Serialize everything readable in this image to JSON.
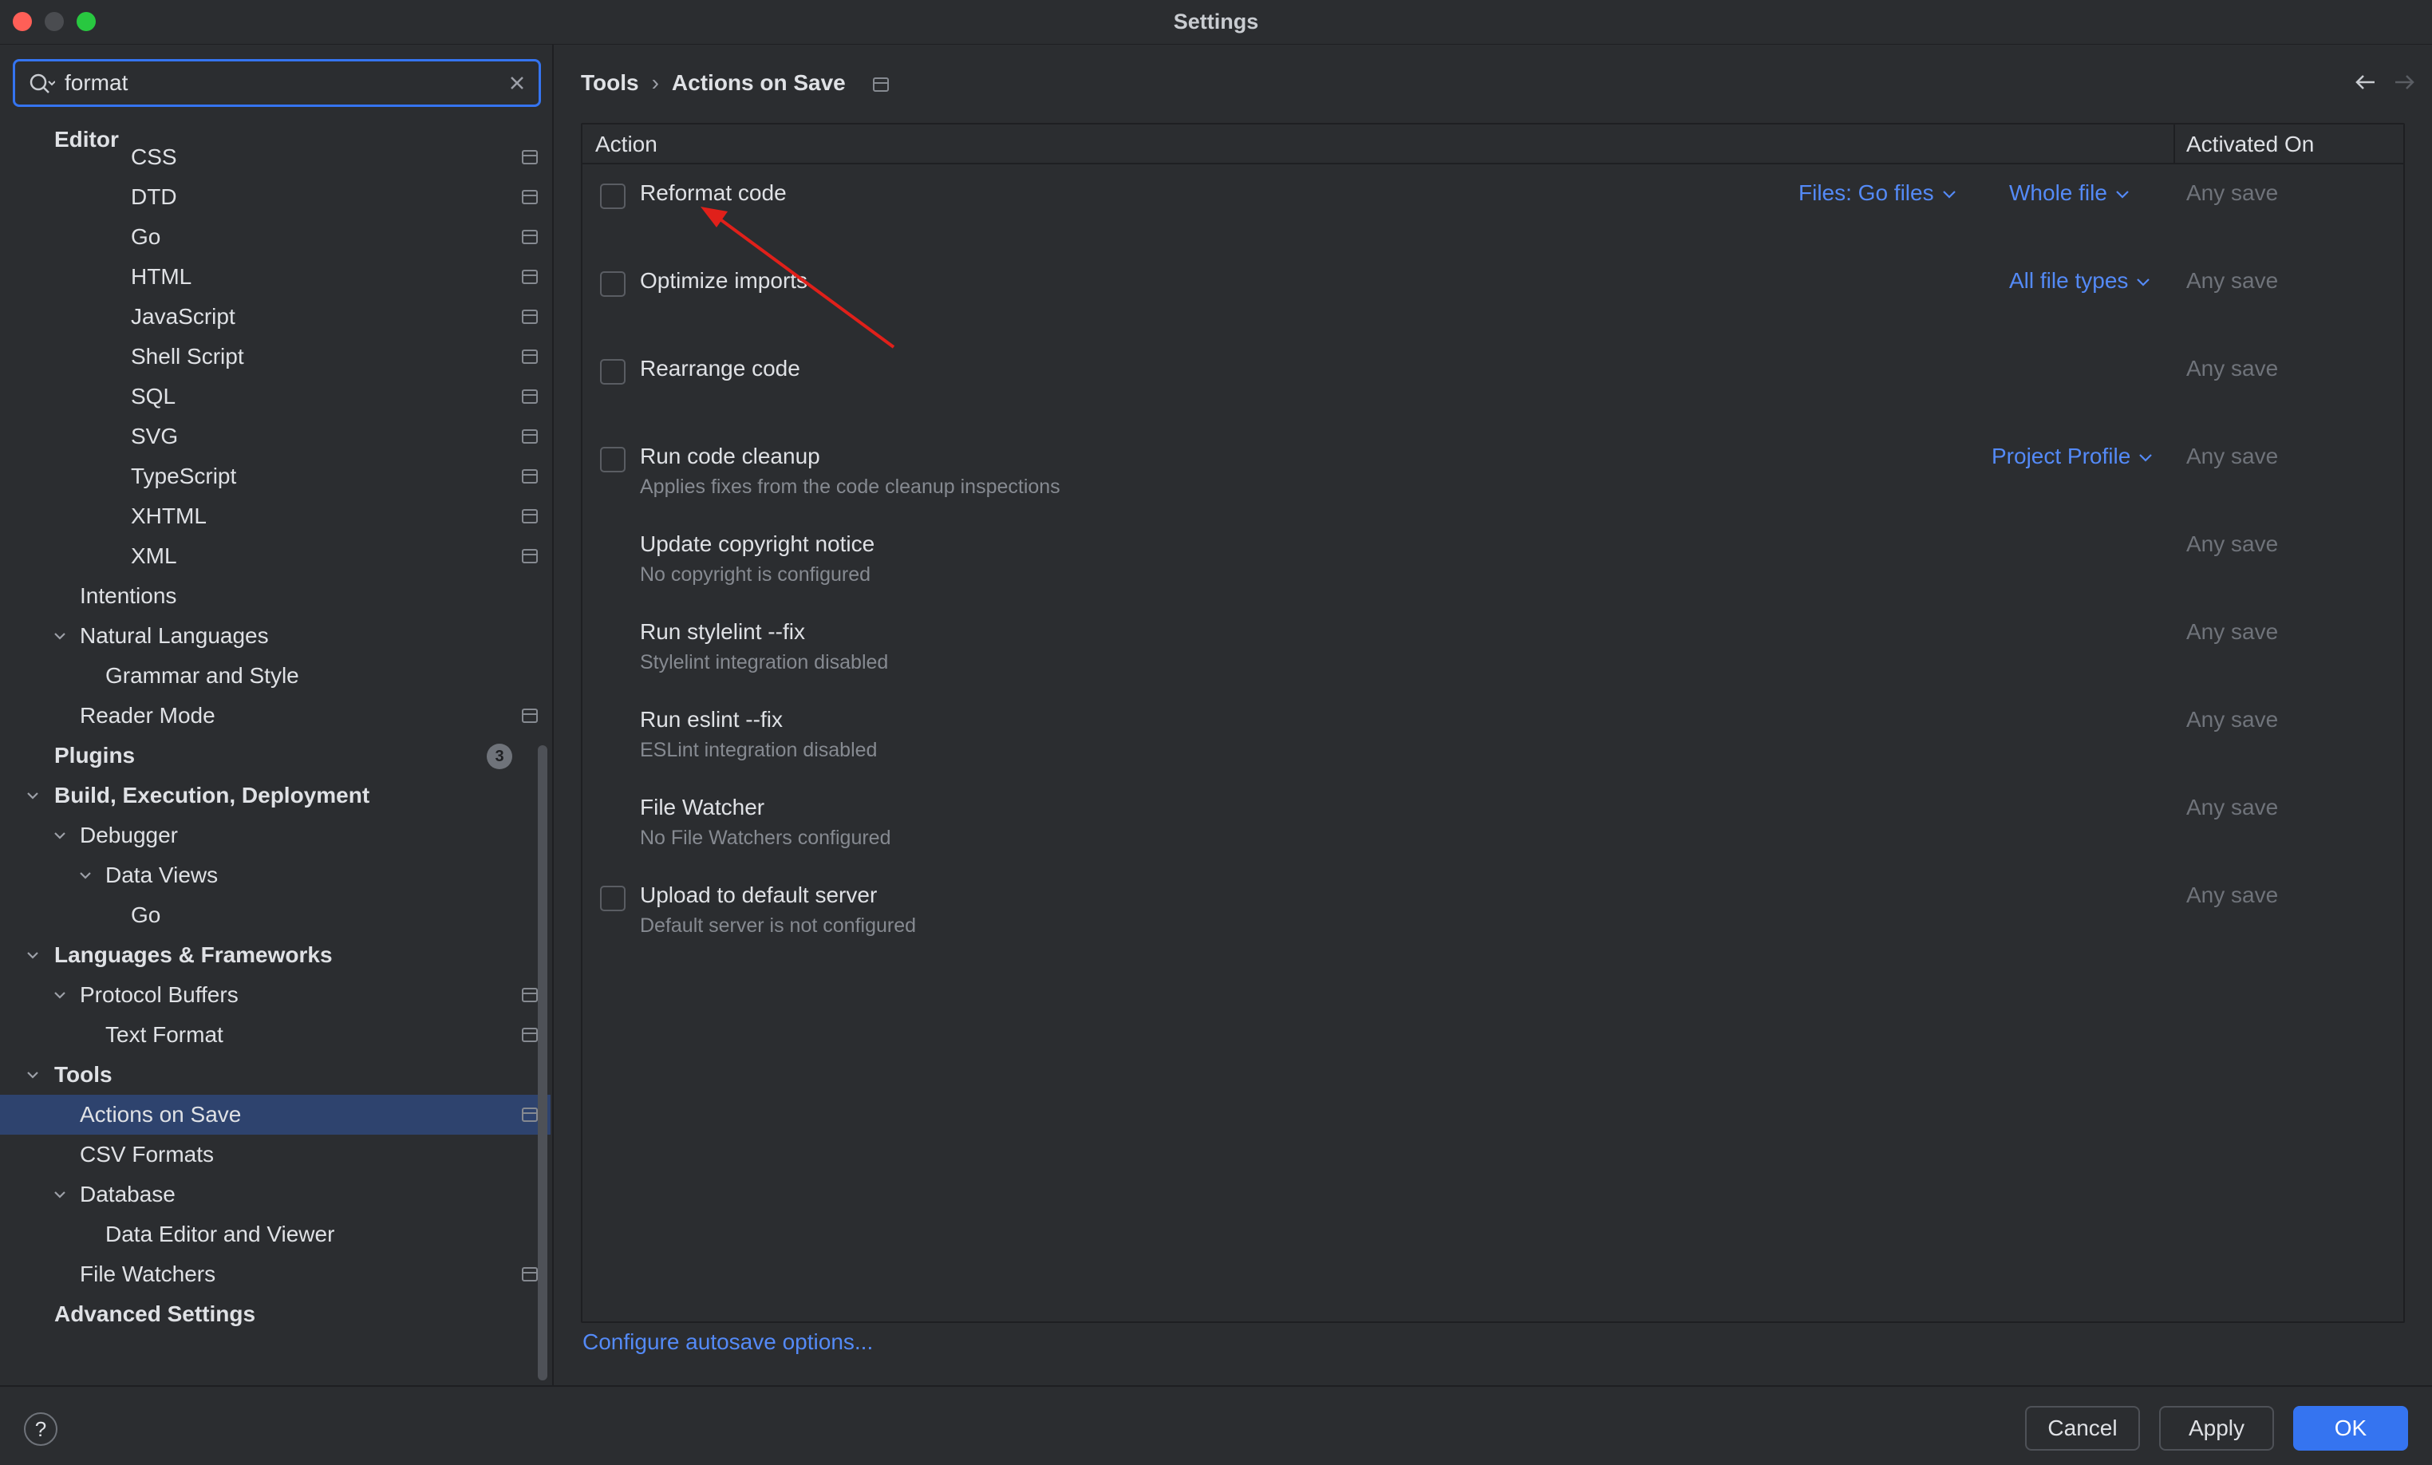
{
  "window": {
    "title": "Settings"
  },
  "search": {
    "value": "format",
    "placeholder": ""
  },
  "tree": {
    "editor": "Editor",
    "css": "CSS",
    "dtd": "DTD",
    "go": "Go",
    "html": "HTML",
    "javascript": "JavaScript",
    "shell_script": "Shell Script",
    "sql": "SQL",
    "svg": "SVG",
    "typescript": "TypeScript",
    "xhtml": "XHTML",
    "xml": "XML",
    "intentions": "Intentions",
    "natural_languages": "Natural Languages",
    "grammar_style": "Grammar and Style",
    "reader_mode": "Reader Mode",
    "plugins": "Plugins",
    "plugins_badge": "3",
    "build": "Build, Execution, Deployment",
    "debugger": "Debugger",
    "data_views": "Data Views",
    "dv_go": "Go",
    "languages": "Languages & Frameworks",
    "protocol_buffers": "Protocol Buffers",
    "text_format": "Text Format",
    "tools": "Tools",
    "actions_on_save": "Actions on Save",
    "csv_formats": "CSV Formats",
    "database": "Database",
    "data_editor": "Data Editor and Viewer",
    "file_watchers": "File Watchers",
    "advanced": "Advanced Settings"
  },
  "breadcrumb": {
    "parent": "Tools",
    "separator": "›",
    "current": "Actions on Save"
  },
  "table": {
    "col_action": "Action",
    "col_activated": "Activated On",
    "rows": [
      {
        "title": "Reformat code",
        "sub": "",
        "link1": "Files: Go files",
        "link2": "Whole file",
        "activated": "Any save",
        "checked": false
      },
      {
        "title": "Optimize imports",
        "sub": "",
        "link1": "All file types",
        "link2": "",
        "activated": "Any save",
        "checked": false
      },
      {
        "title": "Rearrange code",
        "sub": "",
        "link1": "",
        "link2": "",
        "activated": "Any save",
        "checked": false
      },
      {
        "title": "Run code cleanup",
        "sub": "Applies fixes from the code cleanup inspections",
        "link1": "Project Profile",
        "link2": "",
        "activated": "Any save",
        "checked": false
      },
      {
        "title": "Update copyright notice",
        "sub": "No copyright is configured",
        "link1": "",
        "link2": "",
        "activated": "Any save"
      },
      {
        "title": "Run stylelint --fix",
        "sub": "Stylelint integration disabled",
        "link1": "",
        "link2": "",
        "activated": "Any save"
      },
      {
        "title": "Run eslint --fix",
        "sub": "ESLint integration disabled",
        "link1": "",
        "link2": "",
        "activated": "Any save"
      },
      {
        "title": "File Watcher",
        "sub": "No File Watchers configured",
        "link1": "",
        "link2": "",
        "activated": "Any save"
      },
      {
        "title": "Upload to default server",
        "sub": "Default server is not configured",
        "link1": "",
        "link2": "",
        "activated": "Any save",
        "checked": false
      }
    ]
  },
  "configure_link": "Configure autosave options...",
  "buttons": {
    "help": "?",
    "cancel": "Cancel",
    "apply": "Apply",
    "ok": "OK"
  },
  "icons": {
    "search": "search-icon",
    "clear": "close-icon",
    "chevron": "chevron-down-icon",
    "project": "project-level-icon",
    "back": "arrow-left-icon",
    "forward": "arrow-right-icon",
    "annotation": "red-arrow-annotation"
  },
  "colors": {
    "accent": "#3574f0",
    "link": "#548af7",
    "selection": "#2e436e",
    "annotation": "#e0201a",
    "background": "#2b2d30"
  }
}
